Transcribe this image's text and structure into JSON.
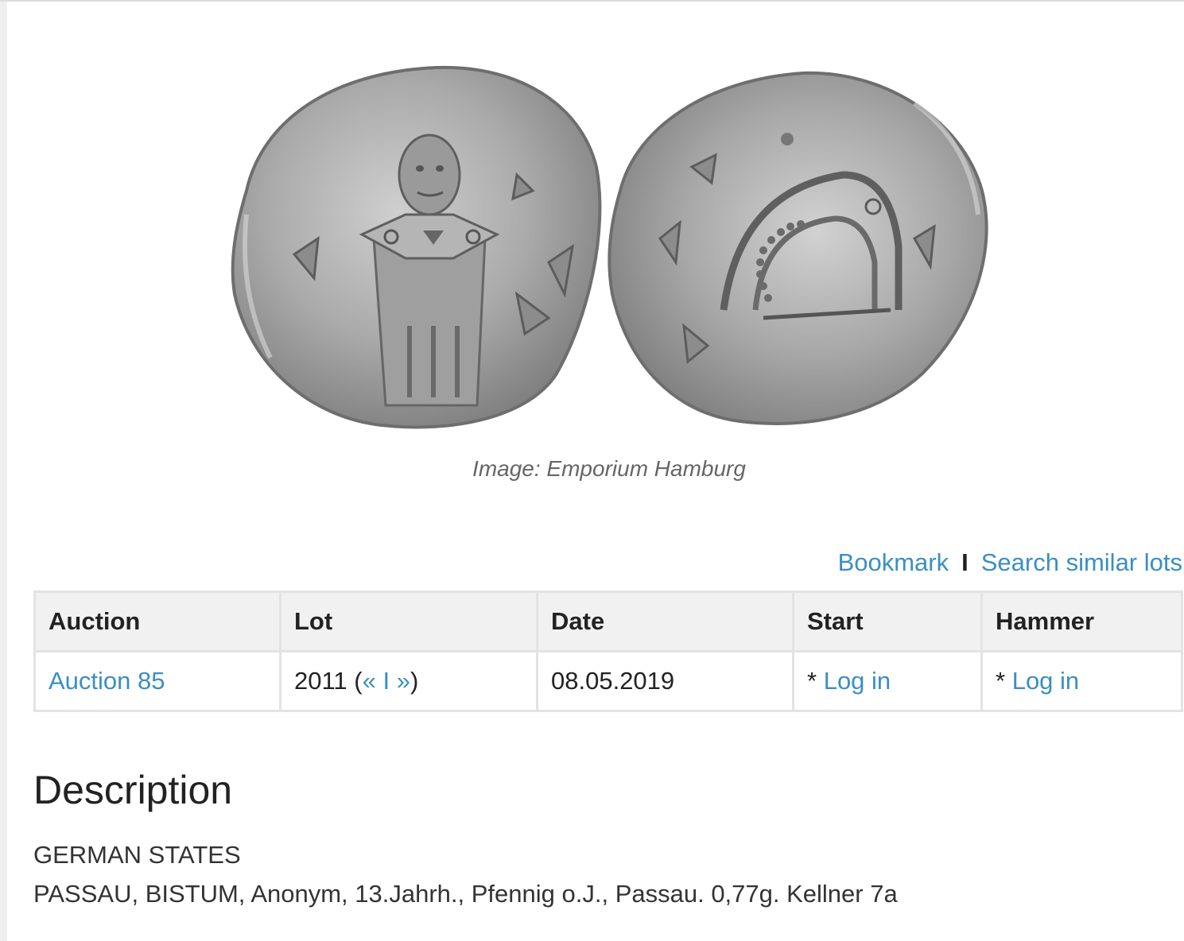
{
  "image_caption": "Image: Emporium Hamburg",
  "actions": {
    "bookmark": "Bookmark",
    "separator": "I",
    "search_similar": "Search similar lots"
  },
  "table": {
    "headers": [
      "Auction",
      "Lot",
      "Date",
      "Start",
      "Hammer"
    ],
    "row": {
      "auction": "Auction 85",
      "lot_number": "2011",
      "lot_open": "(",
      "prev": "«",
      "nav_sep": "I",
      "next": "»",
      "lot_close": ")",
      "date": "08.05.2019",
      "start_prefix": "*",
      "start_link": "Log in",
      "hammer_prefix": "*",
      "hammer_link": "Log in"
    }
  },
  "description": {
    "heading": "Description",
    "line1": "GERMAN STATES",
    "line2": "PASSAU, BISTUM, Anonym, 13.Jahrh., Pfennig o.J., Passau. 0,77g. Kellner 7a"
  },
  "colors": {
    "link": "#3a8fc4",
    "header_bg": "#f1f1f1",
    "coin_silver": "#a9a9a9"
  }
}
